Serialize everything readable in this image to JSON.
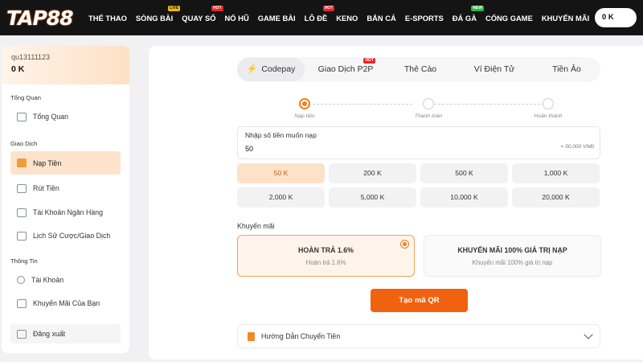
{
  "brand": {
    "logo": "TAP88"
  },
  "nav": [
    {
      "label": "THỂ THAO",
      "badge": "",
      "badge_type": ""
    },
    {
      "label": "SÒNG BÀI",
      "badge": "LIVE",
      "badge_type": "live"
    },
    {
      "label": "QUAY SỐ",
      "badge": "HOT",
      "badge_type": "hot"
    },
    {
      "label": "NỔ HŨ",
      "badge": "",
      "badge_type": ""
    },
    {
      "label": "GAME BÀI",
      "badge": "",
      "badge_type": ""
    },
    {
      "label": "LÔ ĐỀ",
      "badge": "HOT",
      "badge_type": "hot"
    },
    {
      "label": "KENO",
      "badge": "",
      "badge_type": ""
    },
    {
      "label": "BẮN CÁ",
      "badge": "",
      "badge_type": ""
    },
    {
      "label": "E-SPORTS",
      "badge": "",
      "badge_type": ""
    },
    {
      "label": "ĐÁ GÀ",
      "badge": "NEW",
      "badge_type": "new"
    },
    {
      "label": "CỔNG GAME",
      "badge": "",
      "badge_type": ""
    },
    {
      "label": "KHUYẾN MÃI",
      "badge": "",
      "badge_type": ""
    }
  ],
  "header": {
    "balance": "0 K"
  },
  "sidebar": {
    "username": "qu13111123",
    "balance": "0 K",
    "sections": [
      {
        "title": "Tổng Quan"
      },
      {
        "title": "Giao Dịch"
      },
      {
        "title": "Thông Tin"
      }
    ],
    "items": [
      {
        "label": "Tổng Quan",
        "icon": "dashboard-icon"
      },
      {
        "label": "Nạp Tiền",
        "icon": "deposit-icon"
      },
      {
        "label": "Rút Tiền",
        "icon": "withdraw-icon"
      },
      {
        "label": "Tài Khoản Ngân Hàng",
        "icon": "bank-icon"
      },
      {
        "label": "Lịch Sử Cược/Giao Dịch",
        "icon": "history-icon"
      },
      {
        "label": "Tài Khoản",
        "icon": "account-icon"
      },
      {
        "label": "Khuyến Mãi Của Bạn",
        "icon": "promotion-icon"
      },
      {
        "label": "Đăng xuất",
        "icon": "logout-icon"
      }
    ]
  },
  "tabs": [
    {
      "label": "Codepay",
      "active": true
    },
    {
      "label": "Giao Dịch P2P",
      "badge": "HOT"
    },
    {
      "label": "Thẻ Cào"
    },
    {
      "label": "Ví Điện Tử"
    },
    {
      "label": "Tiền Ảo"
    }
  ],
  "steps": [
    {
      "label": "Nạp tiền",
      "current": true
    },
    {
      "label": "Thanh toán",
      "current": false
    },
    {
      "label": "Hoàn thành",
      "current": false
    }
  ],
  "amount": {
    "label": "Nhập số tiền muốn nạp",
    "value": "50",
    "hint": "= 50,000 VNĐ"
  },
  "quick_amounts": [
    {
      "label": "50 K",
      "active": true
    },
    {
      "label": "200 K"
    },
    {
      "label": "500 K"
    },
    {
      "label": "1,000 K"
    },
    {
      "label": "2,000 K"
    },
    {
      "label": "5,000 K"
    },
    {
      "label": "10,000 K"
    },
    {
      "label": "20,000 K"
    }
  ],
  "promotions": {
    "title": "Khuyến mãi",
    "options": [
      {
        "name": "HOÀN TRẢ 1.6%",
        "subtitle": "Hoàn trả 1.6%",
        "selected": true
      },
      {
        "name": "KHUYẾN MÃI 100% GIÁ TRỊ NẠP",
        "subtitle": "Khuyến mãi 100% giá trị nạp",
        "selected": false
      }
    ]
  },
  "actions": {
    "create_qr": "Tạo mã QR"
  },
  "guide": {
    "label": "Hướng Dẫn Chuyển Tiền"
  },
  "colors": {
    "accent": "#f0620f",
    "topbar": "#141414",
    "active_bg": "#fde3cc"
  }
}
